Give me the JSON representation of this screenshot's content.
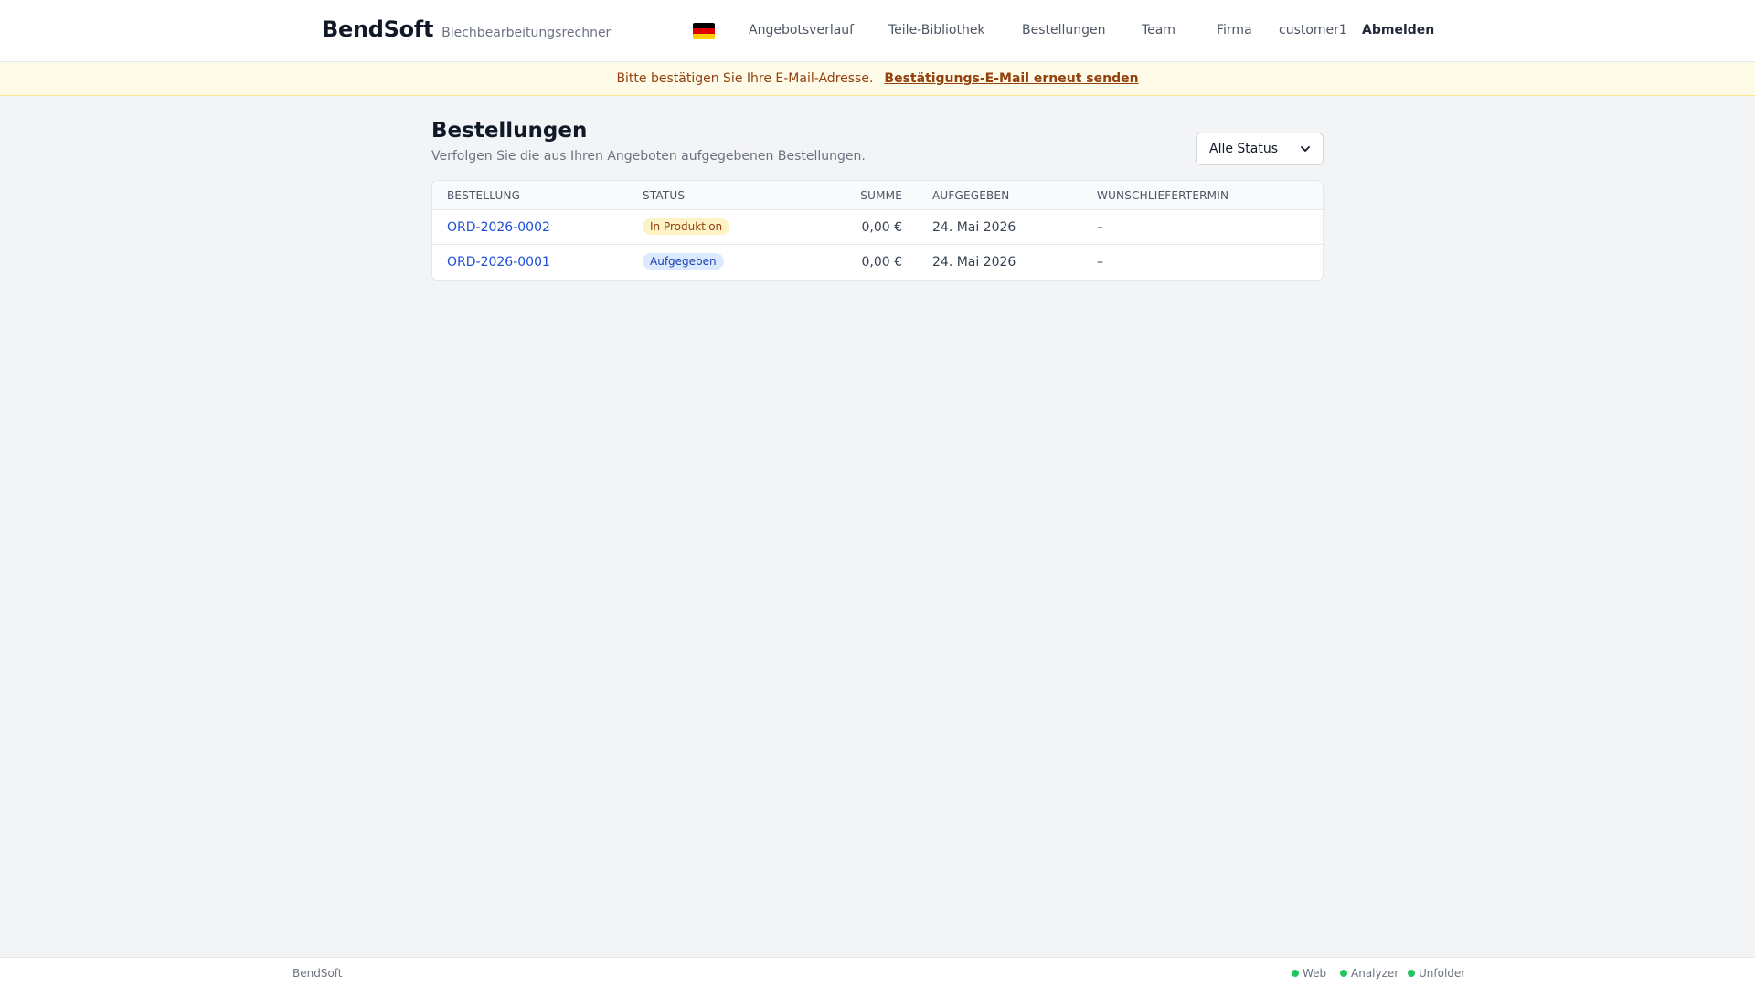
{
  "header": {
    "brand_name": "BendSoft",
    "brand_tagline": "Blechbearbeitungsrechner",
    "nav": {
      "quotes": "Angebotsverlauf",
      "parts": "Teile-Bibliothek",
      "orders": "Bestellungen",
      "team": "Team",
      "company": "Firma",
      "user": "customer1",
      "logout": "Abmelden"
    },
    "language_icon": "german-flag-icon"
  },
  "banner": {
    "text": "Bitte bestätigen Sie Ihre E-Mail-Adresse.",
    "link": "Bestätigungs-E-Mail erneut senden"
  },
  "page": {
    "title": "Bestellungen",
    "subtitle": "Verfolgen Sie die aus Ihren Angeboten aufgegebenen Bestellungen.",
    "status_filter": "Alle Status"
  },
  "table": {
    "headers": {
      "order": "Bestellung",
      "status": "Status",
      "sum": "Summe",
      "placed": "Aufgegeben",
      "delivery": "Wunschliefertermin"
    },
    "rows": [
      {
        "order": "ORD-2026-0002",
        "status": "In Produktion",
        "sum": "0,00 €",
        "placed": "24. Mai 2026",
        "delivery": "–"
      },
      {
        "order": "ORD-2026-0001",
        "status": "Aufgegeben",
        "sum": "0,00 €",
        "placed": "24. Mai 2026",
        "delivery": "–"
      }
    ]
  },
  "footer": {
    "brand": "BendSoft",
    "services": [
      "Web",
      "Analyzer",
      "Unfolder"
    ]
  },
  "colors": {
    "status_ok": "#22c55e",
    "link": "#1d4ed8",
    "banner_bg": "#fefce8"
  }
}
